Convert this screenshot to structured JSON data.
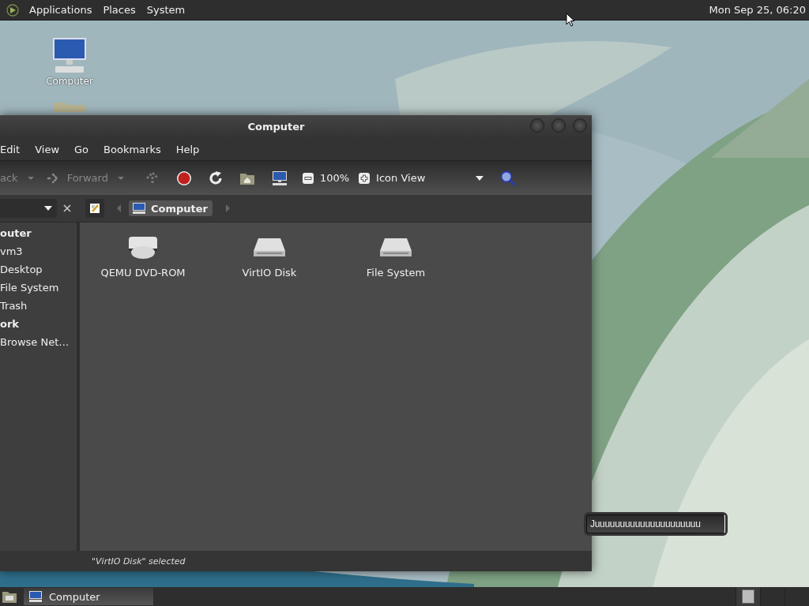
{
  "top_panel": {
    "menus": [
      "Applications",
      "Places",
      "System"
    ],
    "clock": "Mon Sep 25, 06:20"
  },
  "desktop_icons": [
    {
      "kind": "computer",
      "label": "Computer"
    },
    {
      "kind": "folder"
    }
  ],
  "window": {
    "title": "Computer",
    "menu": [
      "Edit",
      "View",
      "Go",
      "Bookmarks",
      "Help"
    ],
    "toolbar": [
      {
        "kind": "back",
        "label": "ack",
        "disabled": true
      },
      {
        "kind": "forward",
        "label": "Forward",
        "disabled": true
      },
      {
        "kind": "up",
        "disabled": true
      },
      {
        "kind": "stop",
        "disabled": false
      },
      {
        "kind": "reload",
        "disabled": false
      },
      {
        "kind": "home",
        "disabled": false
      },
      {
        "kind": "computer",
        "disabled": false
      },
      {
        "kind": "zoom_out",
        "disabled": false
      },
      {
        "kind": "zoom_level",
        "label": "100%"
      },
      {
        "kind": "zoom_in",
        "disabled": false
      },
      {
        "kind": "view_select",
        "label": "Icon View"
      },
      {
        "kind": "search",
        "disabled": false
      }
    ],
    "pathbar": [
      {
        "label": "Computer",
        "selected": true
      }
    ],
    "sidebar": [
      {
        "kind": "heading",
        "label": "outer"
      },
      {
        "kind": "place",
        "label": "vm3"
      },
      {
        "kind": "place",
        "label": "Desktop"
      },
      {
        "kind": "place",
        "label": "File System"
      },
      {
        "kind": "place",
        "label": "Trash"
      },
      {
        "kind": "heading",
        "label": "ork"
      },
      {
        "kind": "place",
        "label": "Browse Net…"
      }
    ],
    "items": [
      {
        "kind": "optical",
        "name": "QEMU DVD-ROM"
      },
      {
        "kind": "disk",
        "name": "VirtIO Disk"
      },
      {
        "kind": "disk",
        "name": "File System"
      }
    ],
    "status": "\"VirtIO Disk\" selected"
  },
  "taskbar": [
    {
      "label": "Computer",
      "selected": true
    }
  ],
  "popup_field": {
    "value": "Juuuuuuuuuuuuuuuuuuuuu"
  }
}
